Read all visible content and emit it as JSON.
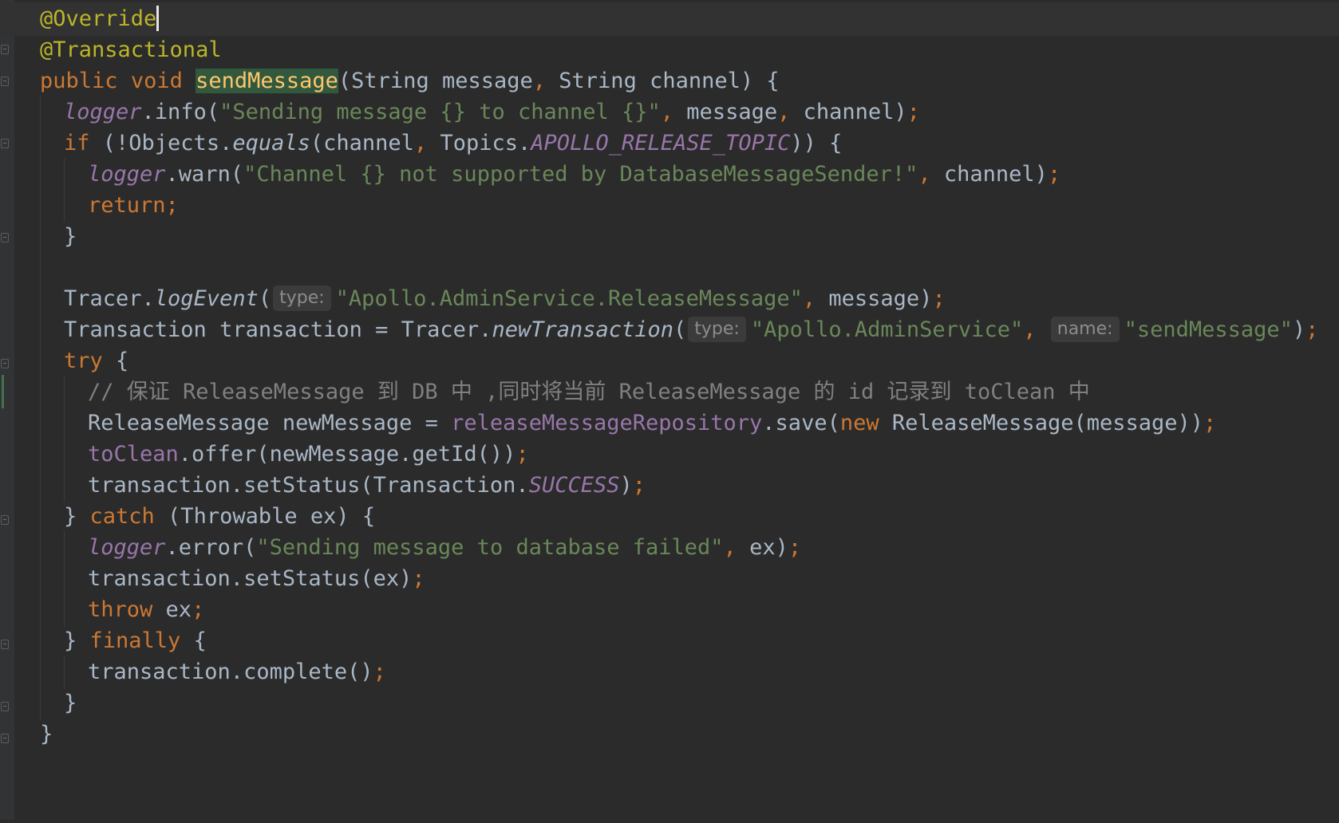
{
  "editor": {
    "language": "java",
    "caret_line": 1,
    "tokens": {
      "override": "@Override",
      "transactional": "@Transactional",
      "public": "public",
      "void": "void",
      "method": "sendMessage",
      "params": "(String message",
      "params2": " String channel) {",
      "logger": "logger",
      "info": ".info(",
      "info_str": "\"Sending message {} to channel {}\"",
      "info_args1": " message",
      "info_args2": " channel)",
      "if": "if",
      "if_open": " (!Objects.",
      "equals": "equals",
      "if_args1": "(channel",
      "if_args2": " Topics.",
      "release_topic": "APOLLO_RELEASE_TOPIC",
      "if_close": ")) {",
      "warn": ".warn(",
      "warn_str": "\"Channel {} not supported by DatabaseMessageSender!\"",
      "warn_args": " channel)",
      "return": "return",
      "close_brace": "}",
      "tracer": "Tracer.",
      "logEvent": "logEvent",
      "paren_open": "(",
      "hint_type": "type:",
      "hint_name": "name:",
      "log_str": "\"Apollo.AdminService.ReleaseMessage\"",
      "log_args": " message)",
      "txn_decl": "Transaction transaction = Tracer.",
      "newTransaction": "newTransaction",
      "txn_str1": "\"Apollo.AdminService\"",
      "txn_str2": "\"sendMessage\"",
      "txn_close": ")",
      "try": "try",
      "open_brace": " {",
      "comment": "// 保证 ReleaseMessage 到 DB 中 ,同时将当前 ReleaseMessage 的 id 记录到 toClean 中",
      "save_decl": "ReleaseMessage newMessage = ",
      "repo": "releaseMessageRepository",
      "save_call": ".save(",
      "new": "new",
      "save_args": " ReleaseMessage(message))",
      "toClean": "toClean",
      "offer": ".offer(newMessage.getId())",
      "set_status": "transaction.setStatus(Transaction.",
      "success": "SUCCESS",
      "close_paren": ")",
      "catch_open": "} ",
      "catch": "catch",
      "catch_args": " (Throwable ex) {",
      "error": ".error(",
      "error_str": "\"Sending message to database failed\"",
      "error_args": " ex)",
      "set_status_ex": "transaction.setStatus(ex)",
      "throw": "throw",
      "throw_args": " ex",
      "finally": "finally",
      "complete": "transaction.complete()",
      "comma": ",",
      "semicolon": ";",
      "space": " "
    }
  }
}
